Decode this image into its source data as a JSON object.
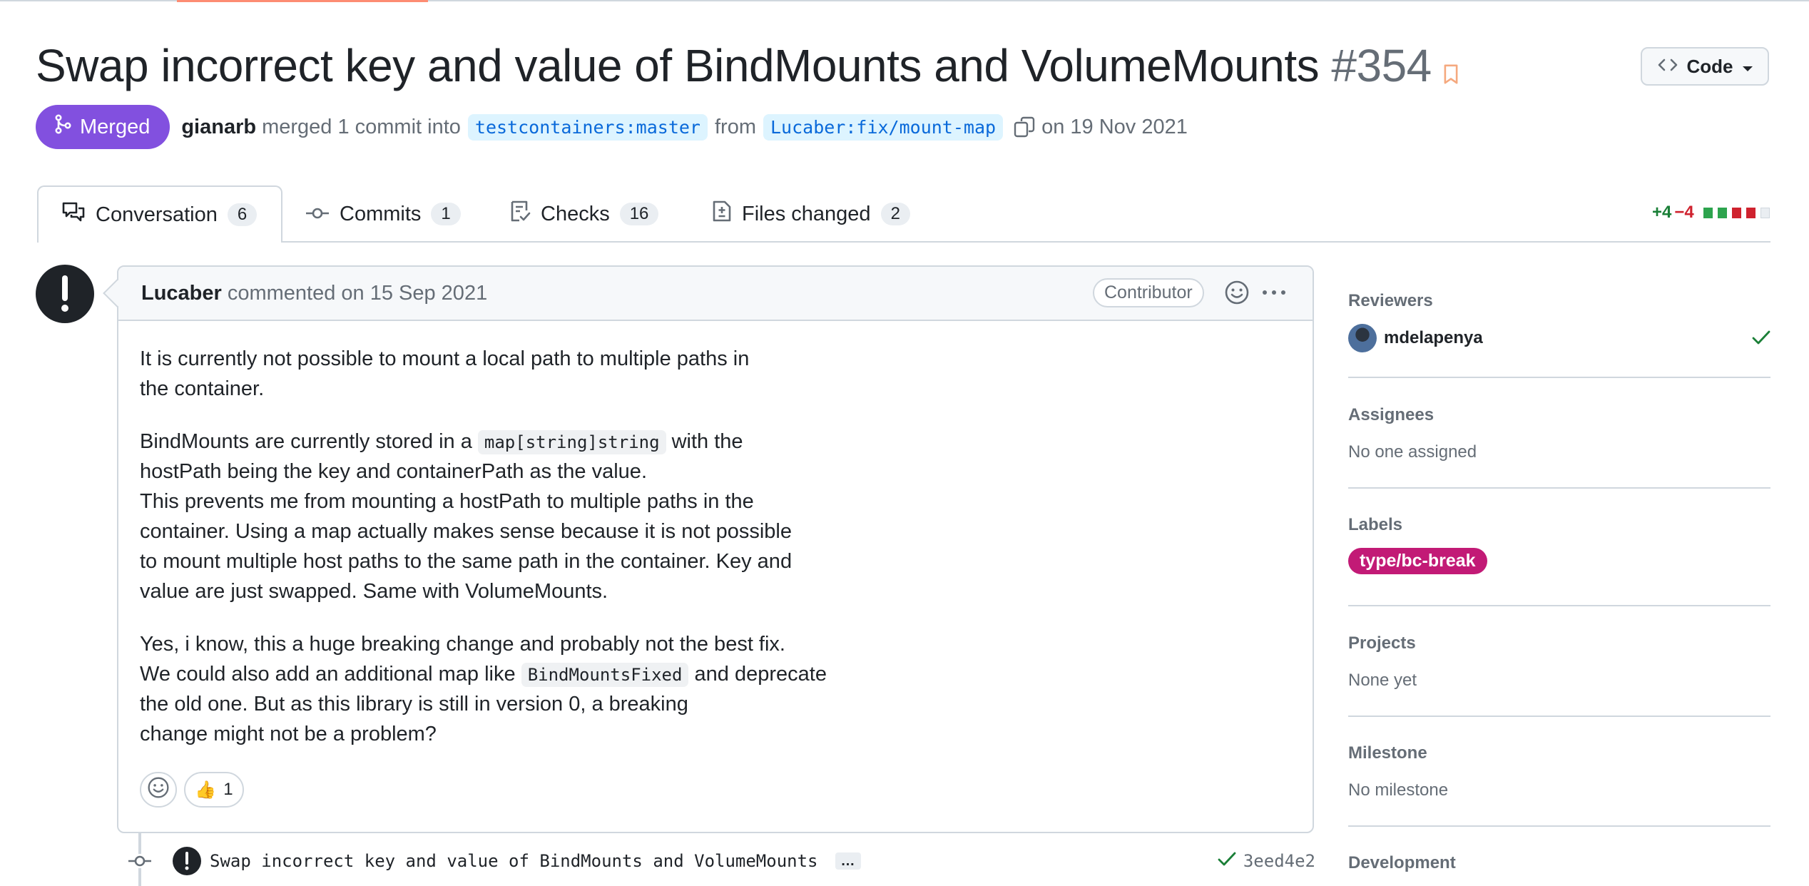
{
  "pr": {
    "title": "Swap incorrect key and value of BindMounts and VolumeMounts",
    "number": "#354",
    "code_button": "Code",
    "state": "Merged",
    "merged_by": "gianarb",
    "merged_text": "merged 1 commit into",
    "base_branch": "testcontainers:master",
    "from_text": "from",
    "head_branch": "Lucaber:fix/mount-map",
    "date_text": "on 19 Nov 2021"
  },
  "tabs": [
    {
      "label": "Conversation",
      "count": "6",
      "icon": "conversation-icon"
    },
    {
      "label": "Commits",
      "count": "1",
      "icon": "commit-icon"
    },
    {
      "label": "Checks",
      "count": "16",
      "icon": "checklist-icon"
    },
    {
      "label": "Files changed",
      "count": "2",
      "icon": "file-diff-icon"
    }
  ],
  "diffstat": {
    "additions": "+4",
    "deletions": "−4",
    "green_blocks": 2,
    "red_blocks": 2,
    "gray_blocks": 1
  },
  "comment": {
    "author": "Lucaber",
    "action": "commented on 15 Sep 2021",
    "role": "Contributor",
    "p1": "It is currently not possible to mount a local path to multiple paths in the container.",
    "p2_l1_pre": "BindMounts are currently stored in a",
    "p2_code": "map[string]string",
    "p2_l1_post": "with the",
    "p2_l2": "hostPath being the key and containerPath as the value.",
    "p2_l3": "This prevents me from mounting a hostPath to multiple paths in the",
    "p2_l4": "container. Using a map actually makes sense because it is not possible",
    "p2_l5": "to mount multiple host paths to the same path in the container. Key and",
    "p2_l6": "value are just swapped. Same with VolumeMounts.",
    "p3_l1": "Yes, i know, this a huge breaking change and probably not the best fix.",
    "p3_l2_pre": "We could also add an additional map like",
    "p3_code": "BindMountsFixed",
    "p3_l2_post": "and deprecate",
    "p3_l3": "the old one. But as this library is still in version 0, a breaking",
    "p3_l4": "change might not be a problem?",
    "reaction_emoji": "👍",
    "reaction_count": "1"
  },
  "commit": {
    "message": "Swap incorrect key and value of BindMounts and VolumeMounts",
    "ellipsis": "…",
    "sha": "3eed4e2"
  },
  "sidebar": {
    "reviewers_title": "Reviewers",
    "reviewer": "mdelapenya",
    "assignees_title": "Assignees",
    "assignees_value": "No one assigned",
    "labels_title": "Labels",
    "label": "type/bc-break",
    "projects_title": "Projects",
    "projects_value": "None yet",
    "milestone_title": "Milestone",
    "milestone_value": "No milestone",
    "development_title": "Development"
  },
  "colors": {
    "merged": "#8250df",
    "label": "#c21a76",
    "add": "#1a7f37",
    "del": "#cf222e",
    "link": "#0969da"
  }
}
